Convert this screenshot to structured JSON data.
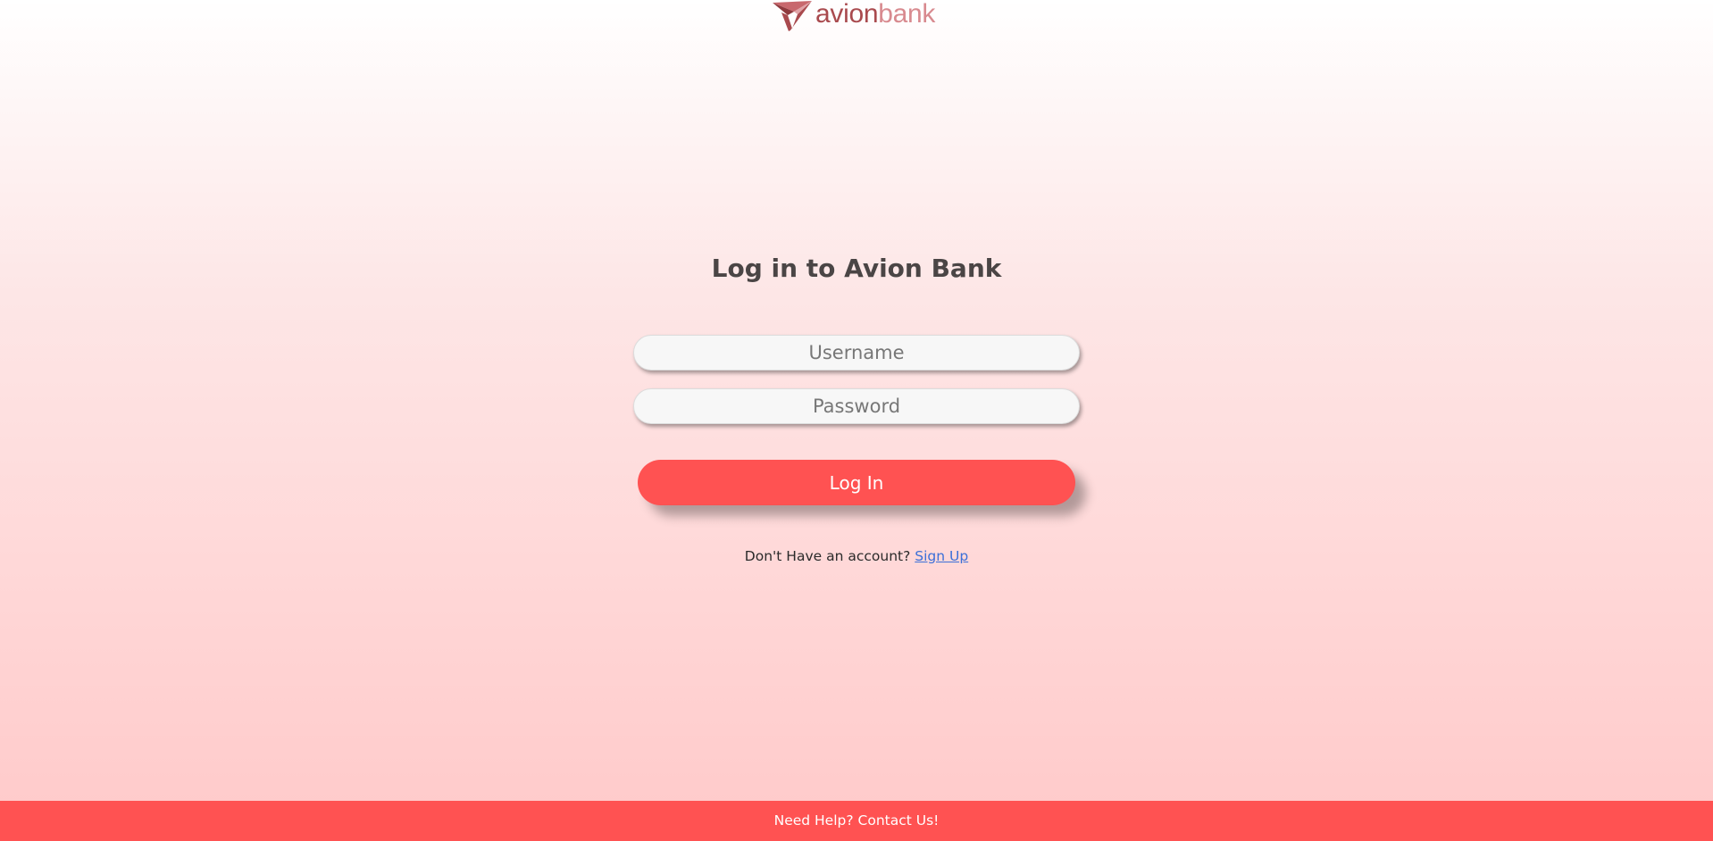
{
  "brand": {
    "logo_part1": "avion",
    "logo_part2": "bank",
    "icon": "paper-plane-logo-icon",
    "colors": {
      "logo_dark": "#a94a4e",
      "logo_light": "#d88a8f",
      "accent": "#ff5252"
    }
  },
  "login": {
    "title": "Log in to Avion Bank",
    "username_placeholder": "Username",
    "password_placeholder": "Password",
    "submit_label": "Log In"
  },
  "signup": {
    "prompt": "Don't Have an account?",
    "link_label": "Sign Up"
  },
  "footer": {
    "help_text": "Need Help? Contact Us!"
  }
}
